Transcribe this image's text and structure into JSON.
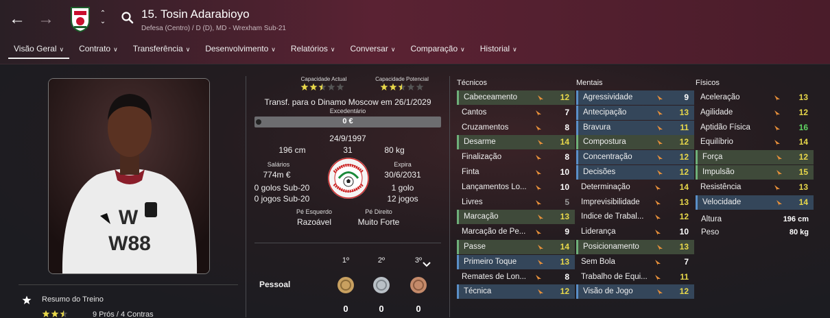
{
  "header": {
    "player_name": "15. Tosin Adarabioyo",
    "player_subtitle": "Defesa (Centro) / D (D), MD - Wrexham Sub-21",
    "club_badge_icon": "wrexham-crest-icon"
  },
  "tabs": [
    {
      "label": "Visão Geral",
      "active": true
    },
    {
      "label": "Contrato"
    },
    {
      "label": "Transferência"
    },
    {
      "label": "Desenvolvimento"
    },
    {
      "label": "Relatórios"
    },
    {
      "label": "Conversar"
    },
    {
      "label": "Comparação"
    },
    {
      "label": "Historial"
    }
  ],
  "ability": {
    "current_label": "Capacidade Actual",
    "current_stars": 2.5,
    "potential_label": "Capacidade Potencial",
    "potential_stars": 2.5
  },
  "transfer": {
    "line": "Transf. para o Dinamo Moscow em 26/1/2029",
    "exceedent_label": "Excedentário",
    "value": "0 €"
  },
  "profile": {
    "dob": "24/9/1997",
    "height": "196 cm",
    "age": "31",
    "weight": "80 kg",
    "wage_label": "Salários",
    "wage": "774m €",
    "expires_label": "Expira",
    "expires": "30/6/2031",
    "goals_u20": "0 golos Sub-20",
    "games_u20": "0 jogos Sub-20",
    "goals_total": "1 golo",
    "games_total": "12 jogos",
    "left_foot_label": "Pé Esquerdo",
    "left_foot": "Razoável",
    "right_foot_label": "Pé Direito",
    "right_foot": "Muito Forte",
    "nation_badge_icon": "nigeria-football-federation-badge"
  },
  "awards": {
    "ranks": [
      "1º",
      "2º",
      "3º"
    ],
    "row_label": "Pessoal",
    "counts": [
      "0",
      "0",
      "0"
    ],
    "medal_colors": [
      "#c8a060",
      "#b9c0c6",
      "#c48a6a"
    ]
  },
  "training": {
    "title": "Resumo do Treino",
    "stars": 2.5,
    "summary": "9 Prós / 4 Contras"
  },
  "attributes": {
    "technical_title": "Técnicos",
    "mental_title": "Mentais",
    "physical_title": "Físicos",
    "technical": [
      {
        "name": "Cabeceamento",
        "value": "12",
        "hl": "green",
        "color": "yellow"
      },
      {
        "name": "Cantos",
        "value": "7",
        "hl": "",
        "color": "white"
      },
      {
        "name": "Cruzamentos",
        "value": "8",
        "hl": "",
        "color": "white"
      },
      {
        "name": "Desarme",
        "value": "14",
        "hl": "green",
        "color": "yellow"
      },
      {
        "name": "Finalização",
        "value": "8",
        "hl": "",
        "color": "white"
      },
      {
        "name": "Finta",
        "value": "10",
        "hl": "",
        "color": "white"
      },
      {
        "name": "Lançamentos Lo...",
        "value": "10",
        "hl": "",
        "color": "white"
      },
      {
        "name": "Livres",
        "value": "5",
        "hl": "",
        "color": "grey"
      },
      {
        "name": "Marcação",
        "value": "13",
        "hl": "green",
        "color": "yellow"
      },
      {
        "name": "Marcação de Pe...",
        "value": "9",
        "hl": "",
        "color": "white"
      },
      {
        "name": "Passe",
        "value": "14",
        "hl": "green",
        "color": "yellow"
      },
      {
        "name": "Primeiro Toque",
        "value": "13",
        "hl": "blue",
        "color": "yellow"
      },
      {
        "name": "Remates de Lon...",
        "value": "8",
        "hl": "",
        "color": "white"
      },
      {
        "name": "Técnica",
        "value": "12",
        "hl": "blue",
        "color": "yellow"
      }
    ],
    "mental": [
      {
        "name": "Agressividade",
        "value": "9",
        "hl": "blue",
        "color": "white"
      },
      {
        "name": "Antecipação",
        "value": "13",
        "hl": "blue",
        "color": "yellow"
      },
      {
        "name": "Bravura",
        "value": "11",
        "hl": "blue",
        "color": "yellow"
      },
      {
        "name": "Compostura",
        "value": "12",
        "hl": "green",
        "color": "yellow"
      },
      {
        "name": "Concentração",
        "value": "12",
        "hl": "blue",
        "color": "yellow"
      },
      {
        "name": "Decisões",
        "value": "12",
        "hl": "blue",
        "color": "yellow"
      },
      {
        "name": "Determinação",
        "value": "14",
        "hl": "",
        "color": "yellow"
      },
      {
        "name": "Imprevisibilidade",
        "value": "13",
        "hl": "",
        "color": "yellow"
      },
      {
        "name": "Índice de Trabal...",
        "value": "12",
        "hl": "",
        "color": "yellow"
      },
      {
        "name": "Liderança",
        "value": "10",
        "hl": "",
        "color": "white"
      },
      {
        "name": "Posicionamento",
        "value": "13",
        "hl": "green",
        "color": "yellow"
      },
      {
        "name": "Sem Bola",
        "value": "7",
        "hl": "",
        "color": "white"
      },
      {
        "name": "Trabalho de Equi...",
        "value": "11",
        "hl": "",
        "color": "yellow"
      },
      {
        "name": "Visão de Jogo",
        "value": "12",
        "hl": "blue",
        "color": "yellow"
      }
    ],
    "physical": [
      {
        "name": "Aceleração",
        "value": "13",
        "hl": "",
        "color": "yellow"
      },
      {
        "name": "Agilidade",
        "value": "12",
        "hl": "",
        "color": "yellow"
      },
      {
        "name": "Aptidão Física",
        "value": "16",
        "hl": "",
        "color": "green"
      },
      {
        "name": "Equilíbrio",
        "value": "14",
        "hl": "",
        "color": "yellow"
      },
      {
        "name": "Força",
        "value": "12",
        "hl": "green",
        "color": "yellow"
      },
      {
        "name": "Impulsão",
        "value": "15",
        "hl": "green",
        "color": "yellow"
      },
      {
        "name": "Resistência",
        "value": "13",
        "hl": "",
        "color": "yellow"
      },
      {
        "name": "Velocidade",
        "value": "14",
        "hl": "blue",
        "color": "yellow"
      }
    ],
    "height_label": "Altura",
    "height_value": "196 cm",
    "weight_label": "Peso",
    "weight_value": "80 kg"
  },
  "colors": {
    "accent": "#5a2233",
    "value_yellow": "#e8d84a",
    "value_green": "#5fd463",
    "arrow_orange": "#e8903a"
  }
}
